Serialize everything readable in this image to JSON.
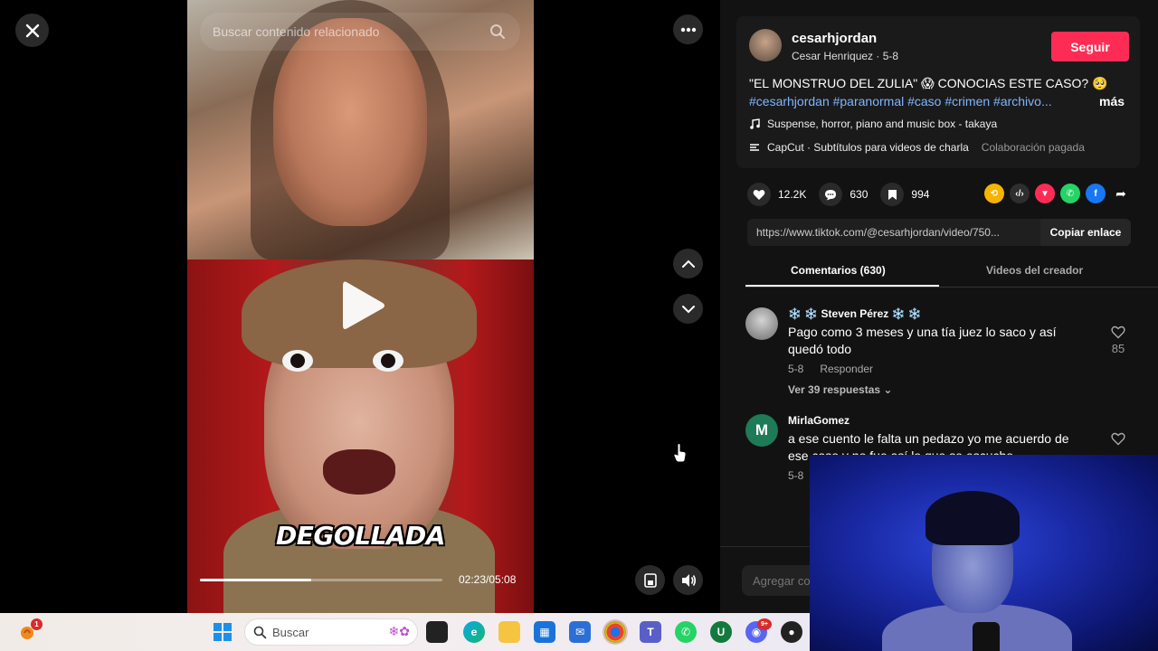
{
  "viewer": {
    "search_placeholder": "Buscar contenido relacionado",
    "caption": "DEGOLLADA",
    "time": "02:23/05:08",
    "progress": 0.46
  },
  "post": {
    "username": "cesarhjordan",
    "display_name_date": "Cesar Henriquez · 5-8",
    "follow_label": "Seguir",
    "description": "\"EL MONSTRUO DEL ZULIA\" 😱 CONOCIAS ESTE CASO? 🥺",
    "hashtags": "#cesarhjordan #paranormal #caso #crimen #archivo...",
    "more_label": "más",
    "music": "Suspense, horror, piano and music box - takaya",
    "capcut": "CapCut · Subtítulos para videos de charla",
    "paid_label": "Colaboración pagada"
  },
  "stats": {
    "likes": "12.2K",
    "comments": "630",
    "saves": "994"
  },
  "share": {
    "url": "https://www.tiktok.com/@cesarhjordan/video/750...",
    "copy_label": "Copiar enlace"
  },
  "tabs": {
    "comments": "Comentarios (630)",
    "creator_videos": "Videos del creador"
  },
  "comments": [
    {
      "name": "❄️ ❄️ Steven Pérez ❄️ ❄️",
      "text": "Pago como 3 meses y una tía juez lo saco y así quedó todo",
      "date": "5-8",
      "reply_label": "Responder",
      "likes": "85",
      "replies_label": "Ver 39 respuestas"
    },
    {
      "name": "MirlaGomez",
      "avatar_letter": "M",
      "text": "a ese cuento le falta un pedazo yo me acuerdo de ese caso y no fue así lo que se escucho",
      "date": "5-8"
    }
  ],
  "add_comment_placeholder": "Agregar comentario...",
  "taskbar": {
    "search_placeholder": "Buscar",
    "notif_badge": "1",
    "discord_badge": "9+"
  },
  "colors": {
    "accent": "#fe2c55",
    "hashtag": "#7fb5ff"
  }
}
